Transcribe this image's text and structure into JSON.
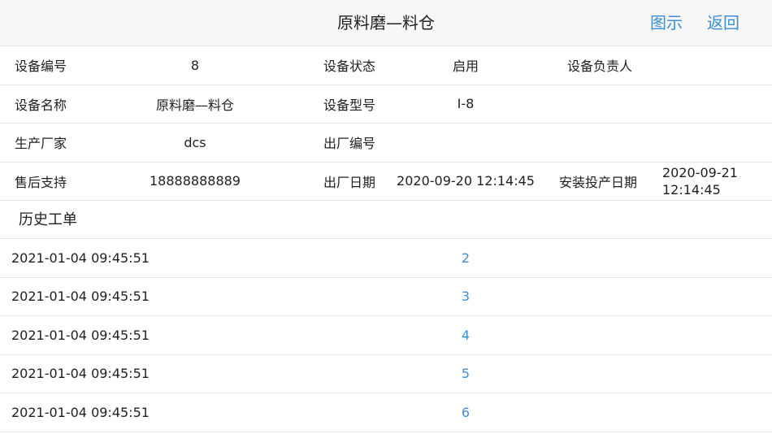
{
  "nav": {
    "title": "原料磨—料仓",
    "chart_label": "图示",
    "back_label": "返回"
  },
  "info": {
    "rows": [
      {
        "l1": "设备编号",
        "v1": "8",
        "l2": "设备状态",
        "v2": "启用",
        "l3": "设备负责人",
        "v3": ""
      },
      {
        "l1": "设备名称",
        "v1": "原料磨—料仓",
        "l2": "设备型号",
        "v2": "I-8",
        "l3": "",
        "v3": ""
      },
      {
        "l1": "生产厂家",
        "v1": "dcs",
        "l2": "出厂编号",
        "v2": "",
        "l3": "",
        "v3": ""
      },
      {
        "l1": "售后支持",
        "v1": "18888888889",
        "l2": "出厂日期",
        "v2": "2020-09-20 12:14:45",
        "l3": "安装投产日期",
        "v3": "2020-09-21\n12:14:45"
      }
    ]
  },
  "history": {
    "title": "历史工单",
    "rows": [
      {
        "date": "2021-01-04 09:45:51",
        "num": "2"
      },
      {
        "date": "2021-01-04 09:45:51",
        "num": "3"
      },
      {
        "date": "2021-01-04 09:45:51",
        "num": "4"
      },
      {
        "date": "2021-01-04 09:45:51",
        "num": "5"
      },
      {
        "date": "2021-01-04 09:45:51",
        "num": "6"
      }
    ]
  },
  "colors": {
    "accent": "#3e8ed8",
    "nav_bg": "#f7f7f7",
    "divider": "#e6e6e6"
  }
}
